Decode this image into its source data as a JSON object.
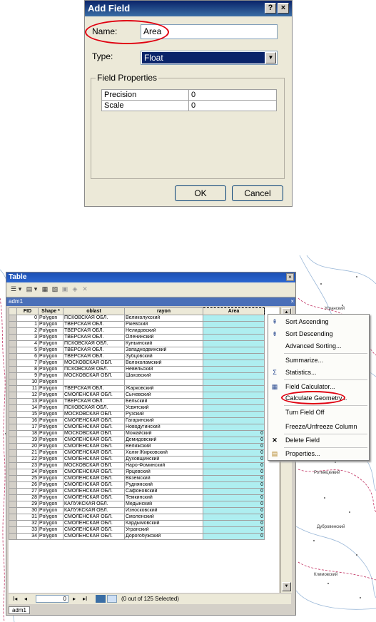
{
  "dialog": {
    "title": "Add Field",
    "help_button": "?",
    "close_button": "×",
    "name_label": "Name:",
    "name_value": "Area",
    "type_label": "Type:",
    "type_value": "Float",
    "group_title": "Field Properties",
    "properties": [
      {
        "key": "Precision",
        "value": "0"
      },
      {
        "key": "Scale",
        "value": "0"
      }
    ],
    "ok": "OK",
    "cancel": "Cancel",
    "highlight_color": "#e00010"
  },
  "table_window": {
    "title": "Table",
    "close": "×",
    "tab": "adm1",
    "tab_close": "×",
    "columns": [
      "FID",
      "Shape *",
      "oblast",
      "rayon",
      "Area"
    ],
    "rows": [
      [
        "0",
        "Polygon",
        "ПСКОВСКАЯ ОБЛ.",
        "Великолукский",
        ""
      ],
      [
        "1",
        "Polygon",
        "ТВЕРСКАЯ ОБЛ.",
        "Ржевский",
        ""
      ],
      [
        "2",
        "Polygon",
        "ТВЕРСКАЯ ОБЛ.",
        "Нелидовский",
        ""
      ],
      [
        "3",
        "Polygon",
        "ТВЕРСКАЯ ОБЛ.",
        "Оленинский",
        ""
      ],
      [
        "4",
        "Polygon",
        "ПСКОВСКАЯ ОБЛ.",
        "Куньинский",
        ""
      ],
      [
        "5",
        "Polygon",
        "ТВЕРСКАЯ ОБЛ.",
        "Западнодвинский",
        ""
      ],
      [
        "6",
        "Polygon",
        "ТВЕРСКАЯ ОБЛ.",
        "Зубцовский",
        ""
      ],
      [
        "7",
        "Polygon",
        "МОСКОВСКАЯ ОБЛ.",
        "Волоколамский",
        ""
      ],
      [
        "8",
        "Polygon",
        "ПСКОВСКАЯ ОБЛ.",
        "Невельский",
        ""
      ],
      [
        "9",
        "Polygon",
        "МОСКОВСКАЯ ОБЛ.",
        "Шаховский",
        ""
      ],
      [
        "10",
        "Polygon",
        "",
        "",
        ""
      ],
      [
        "11",
        "Polygon",
        "ТВЕРСКАЯ ОБЛ.",
        "Жарковский",
        ""
      ],
      [
        "12",
        "Polygon",
        "СМОЛЕНСКАЯ ОБЛ.",
        "Сычевский",
        ""
      ],
      [
        "13",
        "Polygon",
        "ТВЕРСКАЯ ОБЛ.",
        "Бельский",
        ""
      ],
      [
        "14",
        "Polygon",
        "ПСКОВСКАЯ ОБЛ.",
        "Усвятский",
        ""
      ],
      [
        "15",
        "Polygon",
        "МОСКОВСКАЯ ОБЛ.",
        "Рузский",
        ""
      ],
      [
        "16",
        "Polygon",
        "СМОЛЕНСКАЯ ОБЛ.",
        "Гагаринский",
        ""
      ],
      [
        "17",
        "Polygon",
        "СМОЛЕНСКАЯ ОБЛ.",
        "Новодугинский",
        ""
      ],
      [
        "18",
        "Polygon",
        "МОСКОВСКАЯ ОБЛ.",
        "Можайский",
        "0"
      ],
      [
        "19",
        "Polygon",
        "СМОЛЕНСКАЯ ОБЛ.",
        "Демидовский",
        "0"
      ],
      [
        "20",
        "Polygon",
        "СМОЛЕНСКАЯ ОБЛ.",
        "Велижский",
        "0"
      ],
      [
        "21",
        "Polygon",
        "СМОЛЕНСКАЯ ОБЛ.",
        "Холм-Жирковский",
        "0"
      ],
      [
        "22",
        "Polygon",
        "СМОЛЕНСКАЯ ОБЛ.",
        "Духовщинский",
        "0"
      ],
      [
        "23",
        "Polygon",
        "МОСКОВСКАЯ ОБЛ.",
        "Наро-Фоминский",
        "0"
      ],
      [
        "24",
        "Polygon",
        "СМОЛЕНСКАЯ ОБЛ.",
        "Ярцевский",
        "0"
      ],
      [
        "25",
        "Polygon",
        "СМОЛЕНСКАЯ ОБЛ.",
        "Вяземский",
        "0"
      ],
      [
        "26",
        "Polygon",
        "СМОЛЕНСКАЯ ОБЛ.",
        "Руднянский",
        "0"
      ],
      [
        "27",
        "Polygon",
        "СМОЛЕНСКАЯ ОБЛ.",
        "Сафоновский",
        "0"
      ],
      [
        "28",
        "Polygon",
        "СМОЛЕНСКАЯ ОБЛ.",
        "Темкинский",
        "0"
      ],
      [
        "29",
        "Polygon",
        "КАЛУЖСКАЯ ОБЛ.",
        "Медынский",
        "0"
      ],
      [
        "30",
        "Polygon",
        "КАЛУЖСКАЯ ОБЛ.",
        "Износковский",
        "0"
      ],
      [
        "31",
        "Polygon",
        "СМОЛЕНСКАЯ ОБЛ.",
        "Смоленский",
        "0"
      ],
      [
        "32",
        "Polygon",
        "СМОЛЕНСКАЯ ОБЛ.",
        "Кардымовский",
        "0"
      ],
      [
        "33",
        "Polygon",
        "СМОЛЕНСКАЯ ОБЛ.",
        "Угранский",
        "0"
      ],
      [
        "34",
        "Polygon",
        "СМОЛЕНСКАЯ ОБЛ.",
        "Дорогобужский",
        "0"
      ]
    ],
    "nav": {
      "first": "I◂",
      "prev": "◂",
      "record": "0",
      "next": "▸",
      "last": "▸I",
      "status": "(0 out of 125 Selected)"
    },
    "bottom_tab": "adm1"
  },
  "context_menu": {
    "items": [
      {
        "label": "Sort Ascending",
        "icon": "sort-ascending-icon",
        "glyph": "⇞"
      },
      {
        "label": "Sort Descending",
        "icon": "sort-descending-icon",
        "glyph": "⇟"
      },
      {
        "label": "Advanced Sorting...",
        "icon": "",
        "glyph": ""
      },
      {
        "label": "Summarize...",
        "icon": "",
        "glyph": ""
      },
      {
        "label": "Statistics...",
        "icon": "sigma-icon",
        "glyph": "Σ"
      },
      {
        "label": "Field Calculator...",
        "icon": "calculator-icon",
        "glyph": "▦"
      },
      {
        "label": "Calculate Geometry...",
        "icon": "",
        "glyph": ""
      },
      {
        "label": "Turn Field Off",
        "icon": "",
        "glyph": ""
      },
      {
        "label": "Freeze/Unfreeze Column",
        "icon": "",
        "glyph": ""
      },
      {
        "label": "Delete Field",
        "icon": "delete-icon",
        "glyph": "✕"
      },
      {
        "label": "Properties...",
        "icon": "properties-icon",
        "glyph": "▤"
      }
    ]
  },
  "map_labels": [
    "Угранский",
    "Ротмецкивий",
    "Дубровенский",
    "Климовский"
  ]
}
